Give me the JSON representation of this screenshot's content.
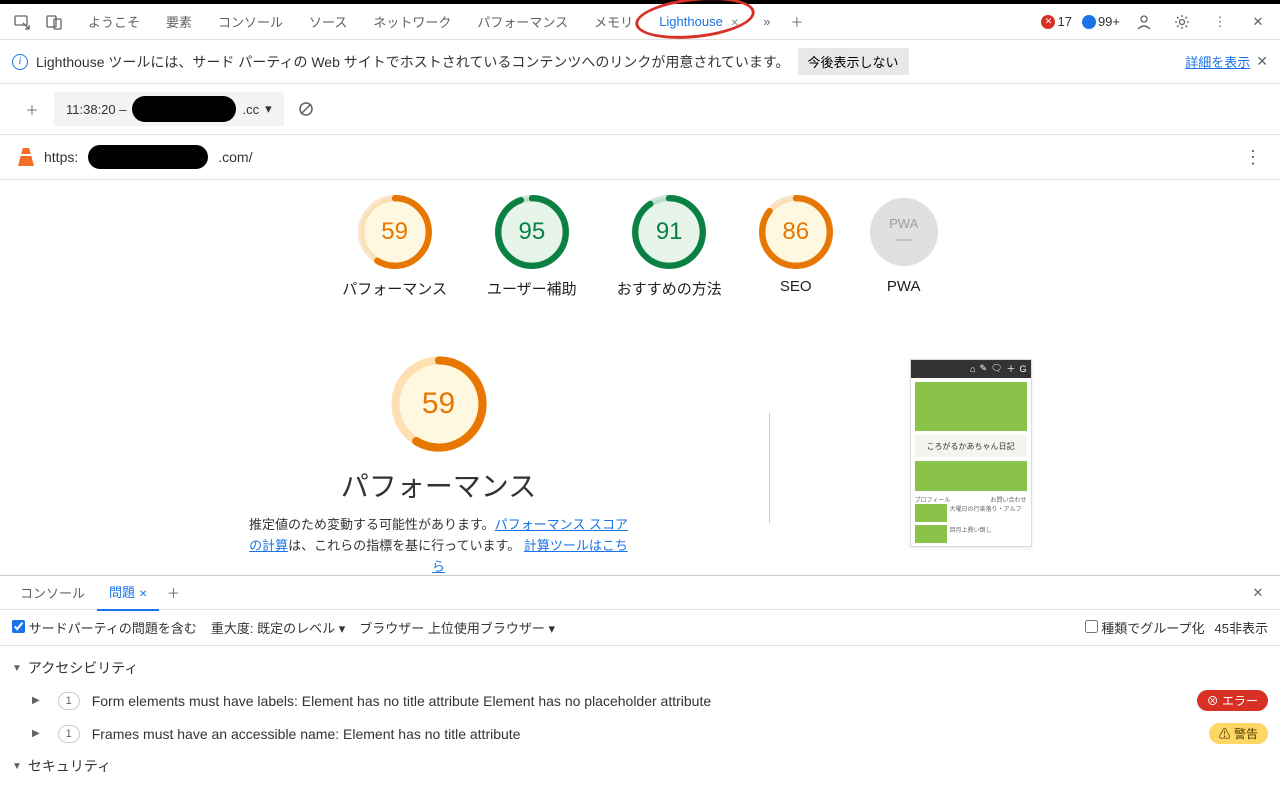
{
  "toolbar": {
    "tabs": [
      "ようこそ",
      "要素",
      "コンソール",
      "ソース",
      "ネットワーク",
      "パフォーマンス",
      "メモリ",
      "Lighthouse"
    ],
    "active_tab": "Lighthouse",
    "errors": "17",
    "messages": "99+"
  },
  "infobar": {
    "text": "Lighthouse ツールには、サード パーティの Web サイトでホストされているコンテンツへのリンクが用意されています。",
    "dismiss": "今後表示しない",
    "detail": "詳細を表示"
  },
  "subbar": {
    "timestamp": "11:38:20 –",
    "suffix": ".cc"
  },
  "urlbar": {
    "prefix": "https:",
    "suffix": ".com/"
  },
  "gauges": [
    {
      "score": "59",
      "label": "パフォーマンス",
      "class": "g-orange",
      "stroke": "#e67700",
      "pct": 59
    },
    {
      "score": "95",
      "label": "ユーザー補助",
      "class": "g-green",
      "stroke": "#0b8043",
      "pct": 95
    },
    {
      "score": "91",
      "label": "おすすめの方法",
      "class": "g-green",
      "stroke": "#0b8043",
      "pct": 91
    },
    {
      "score": "86",
      "label": "SEO",
      "class": "g-orange",
      "stroke": "#e67700",
      "pct": 86
    },
    {
      "score": "PWA",
      "label": "PWA",
      "class": "g-grey",
      "stroke": "",
      "pct": 0
    }
  ],
  "detail": {
    "score": "59",
    "title": "パフォーマンス",
    "note1": "推定値のため変動する可能性があります。",
    "link1": "パフォーマンス スコアの計算",
    "note2": "は、これらの指標を基に行っています。",
    "link2": "計算ツールはこちら"
  },
  "thumb": {
    "title": "ころがるかあちゃん日記",
    "nav1": "プロフィール",
    "row1": "大曜日の行楽落り・アルフ",
    "row2": "目月上費い倒し"
  },
  "drawer": {
    "tabs": {
      "console": "コンソール",
      "issues": "問題"
    },
    "filter": {
      "third_party": "サードパーティの問題を含む",
      "severity": "重大度: 既定のレベル",
      "browser": "ブラウザー 上位使用ブラウザー",
      "group": "種類でグループ化",
      "hidden": "45非表示"
    },
    "sections": {
      "a11y": "アクセシビリティ",
      "sec": "セキュリティ"
    },
    "issues": [
      {
        "count": "1",
        "text": "Form elements must have labels: Element has no title attribute Element has no placeholder attribute",
        "badge": "エラー",
        "type": "err"
      },
      {
        "count": "1",
        "text": "Frames must have an accessible name: Element has no title attribute",
        "badge": "警告",
        "type": "warn"
      }
    ]
  }
}
